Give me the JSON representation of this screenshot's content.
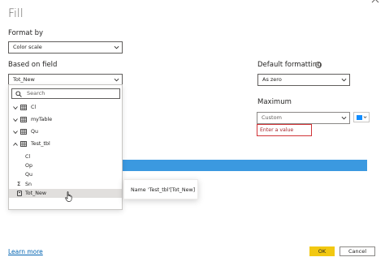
{
  "dialog": {
    "title": "Fill"
  },
  "format_by": {
    "label": "Format by",
    "value": "Color scale"
  },
  "based_on_field": {
    "label": "Based on field",
    "value": "Tot_New",
    "search_placeholder": "Search",
    "tree": [
      {
        "label": "Cl",
        "type": "table",
        "expanded": false
      },
      {
        "label": "myTable",
        "type": "table",
        "expanded": false
      },
      {
        "label": "Qu",
        "type": "table",
        "expanded": false
      },
      {
        "label": "Test_tbl",
        "type": "table",
        "expanded": true
      },
      {
        "label": "Cl",
        "type": "column"
      },
      {
        "label": "Op",
        "type": "column"
      },
      {
        "label": "Qu",
        "type": "column"
      },
      {
        "label": "Sn",
        "type": "sum"
      },
      {
        "label": "Tot_New",
        "type": "measure",
        "hovered": true
      }
    ]
  },
  "tooltip": {
    "name_label": "Name",
    "name_value": "'Test_tbl'[Tot_New]"
  },
  "default_formatting": {
    "label": "Default formatting",
    "value": "As zero"
  },
  "maximum": {
    "label": "Maximum",
    "value": "Custom",
    "input_placeholder": "Enter a value",
    "color": "#118dff"
  },
  "colors": {
    "accent": "#118dff",
    "ok_button": "#f2c811",
    "error_border": "#d13438",
    "gradient": "#3b99e0"
  },
  "footer": {
    "learn_more": "Learn more",
    "ok": "OK",
    "cancel": "Cancel"
  }
}
